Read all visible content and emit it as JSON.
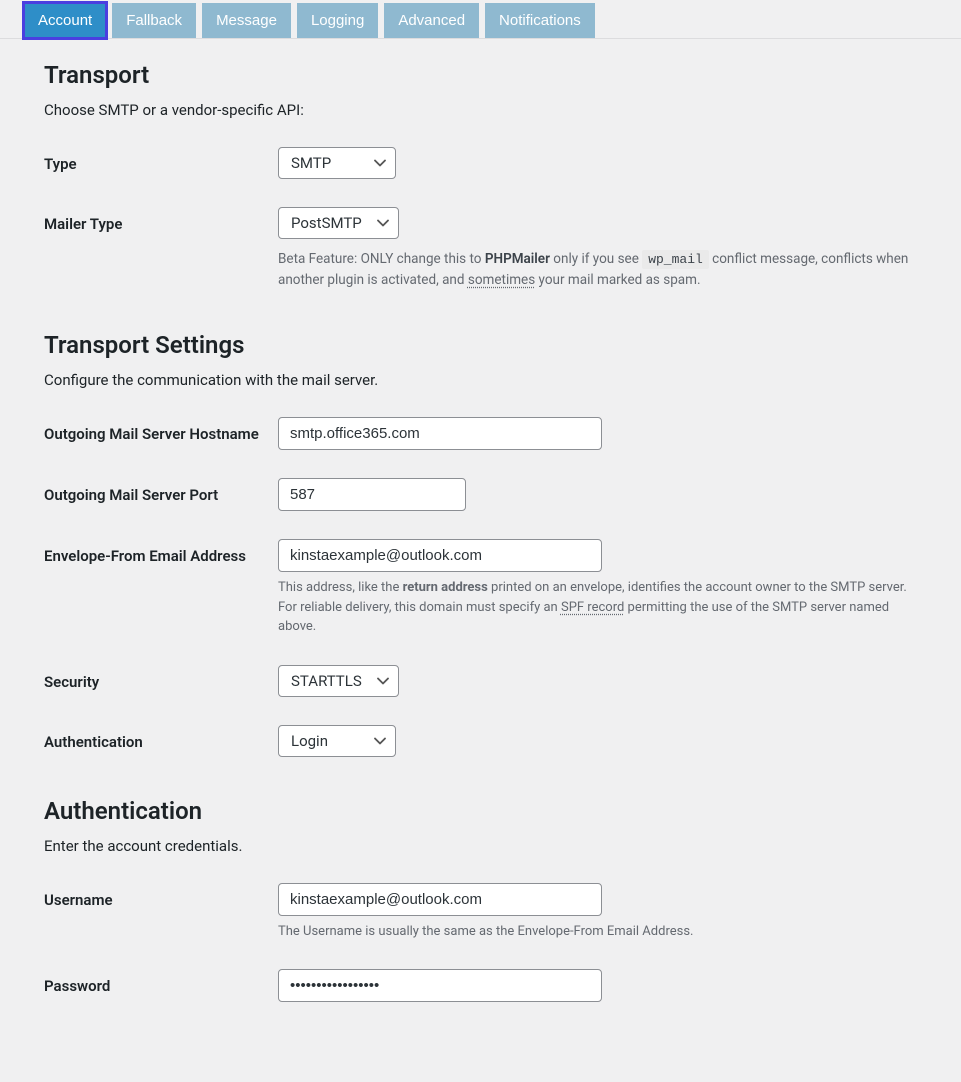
{
  "tabs": [
    {
      "label": "Account",
      "active": true
    },
    {
      "label": "Fallback",
      "active": false
    },
    {
      "label": "Message",
      "active": false
    },
    {
      "label": "Logging",
      "active": false
    },
    {
      "label": "Advanced",
      "active": false
    },
    {
      "label": "Notifications",
      "active": false
    }
  ],
  "transport": {
    "heading": "Transport",
    "desc": "Choose SMTP or a vendor-specific API:",
    "type_label": "Type",
    "type_value": "SMTP",
    "mailer_label": "Mailer Type",
    "mailer_value": "PostSMTP",
    "mailer_help_pre": "Beta Feature: ONLY change this to ",
    "mailer_help_bold1": "PHPMailer",
    "mailer_help_mid1": " only if you see ",
    "mailer_help_code": "wp_mail",
    "mailer_help_mid2": " conflict message, conflicts when another plugin is activated, and ",
    "mailer_help_u": "sometimes",
    "mailer_help_post": " your mail marked as spam."
  },
  "settings": {
    "heading": "Transport Settings",
    "desc": "Configure the communication with the mail server.",
    "hostname_label": "Outgoing Mail Server Hostname",
    "hostname_value": "smtp.office365.com",
    "port_label": "Outgoing Mail Server Port",
    "port_value": "587",
    "envelope_label": "Envelope-From Email Address",
    "envelope_value": "kinstaexample@outlook.com",
    "envelope_help_pre": "This address, like the ",
    "envelope_help_bold": "return address",
    "envelope_help_mid1": " printed on an envelope, identifies the account owner to the SMTP server. For reliable delivery, this domain must specify an ",
    "envelope_help_u": "SPF record",
    "envelope_help_post": " permitting the use of the SMTP server named above.",
    "security_label": "Security",
    "security_value": "STARTTLS",
    "auth_label": "Authentication",
    "auth_value": "Login"
  },
  "auth": {
    "heading": "Authentication",
    "desc": "Enter the account credentials.",
    "username_label": "Username",
    "username_value": "kinstaexample@outlook.com",
    "username_help": "The Username is usually the same as the Envelope-From Email Address.",
    "password_label": "Password",
    "password_value": "•••••••••••••••••"
  }
}
